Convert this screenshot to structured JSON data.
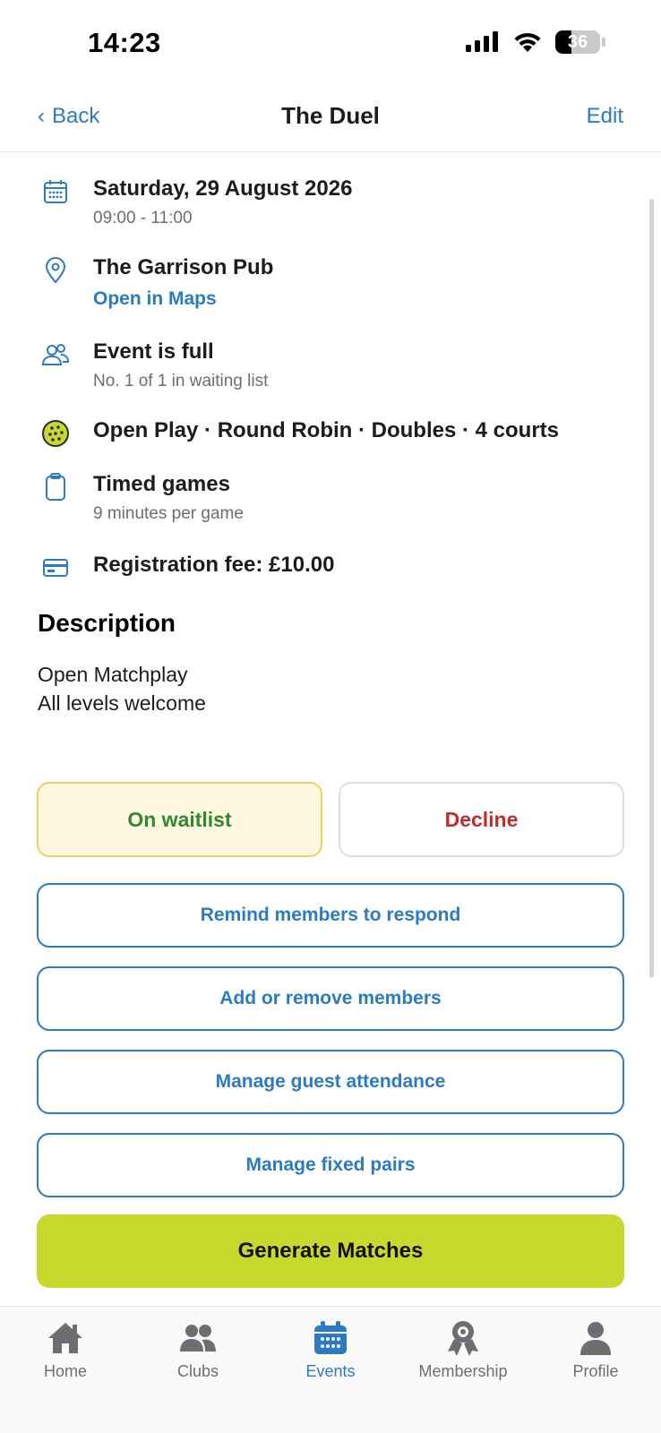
{
  "status_bar": {
    "time": "14:23",
    "battery_level": "36",
    "icons": [
      "signal-icon",
      "wifi-icon",
      "battery-icon"
    ]
  },
  "nav": {
    "back_label": "Back",
    "title": "The Duel",
    "edit_label": "Edit"
  },
  "details": {
    "date": "Saturday, 29 August 2026",
    "time_range": "09:00 - 11:00",
    "venue": "The Garrison Pub",
    "maps_link": "Open in Maps",
    "capacity_status": "Event is full",
    "waitlist_position": "No. 1 of 1 in waiting list",
    "format": "Open Play · Round Robin · Doubles · 4 courts",
    "game_type": "Timed games",
    "game_duration": "9 minutes per game",
    "fee": "Registration fee: £10.00"
  },
  "description": {
    "heading": "Description",
    "lines": [
      "Open Matchplay",
      "All levels welcome"
    ]
  },
  "actions": {
    "rsvp_waitlist": "On waitlist",
    "rsvp_decline": "Decline",
    "remind": "Remind members to respond",
    "add_remove": "Add or remove members",
    "guest_attendance": "Manage guest attendance",
    "fixed_pairs": "Manage fixed pairs",
    "generate": "Generate Matches"
  },
  "tab_bar": {
    "items": [
      {
        "label": "Home",
        "icon": "home-icon"
      },
      {
        "label": "Clubs",
        "icon": "clubs-icon"
      },
      {
        "label": "Events",
        "icon": "calendar-icon",
        "active": true
      },
      {
        "label": "Membership",
        "icon": "membership-badge-icon"
      },
      {
        "label": "Profile",
        "icon": "profile-icon"
      }
    ]
  },
  "colors": {
    "accent": "#2a7bc4",
    "primary_button": "#c8d82c",
    "waitlist_bg": "#fff7e0",
    "waitlist_border": "#f0cf62",
    "waitlist_text": "#2f8a2f",
    "decline_text": "#c32b2b"
  }
}
